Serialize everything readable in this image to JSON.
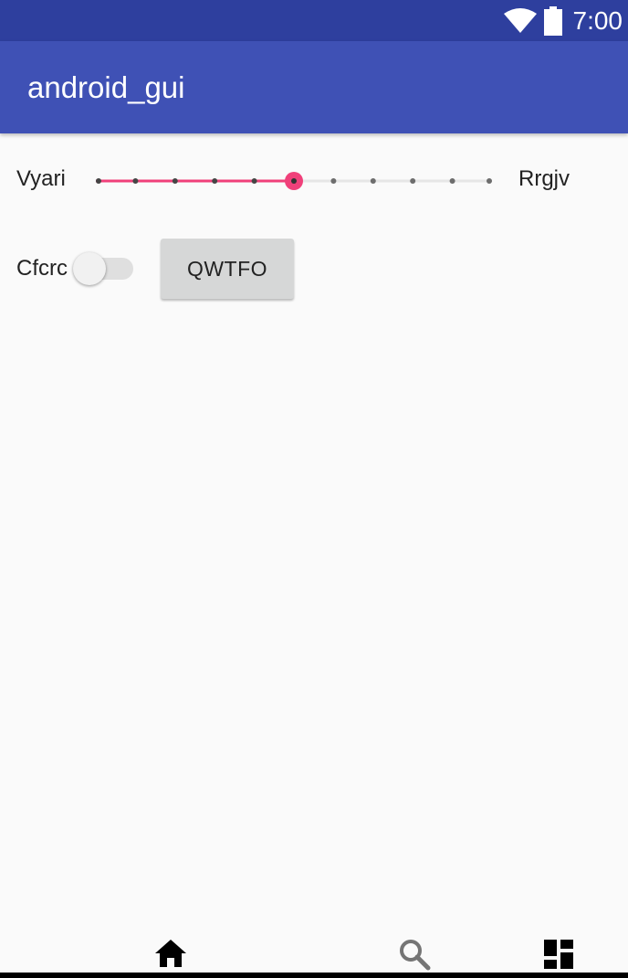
{
  "status_bar": {
    "time": "7:00",
    "icons": [
      "wifi-icon",
      "battery-icon"
    ],
    "background": "#2e3f9e"
  },
  "app_bar": {
    "title": "android_gui",
    "background": "#3f51b5"
  },
  "slider": {
    "left_label": "Vyari",
    "right_label": "Rrgjv",
    "steps": 10,
    "value": 5,
    "accent": "#f0407a"
  },
  "switch": {
    "label": "Cfcrc",
    "checked": false
  },
  "button": {
    "label": "QWTFO"
  },
  "bottom_nav": {
    "items": [
      "home-icon",
      "search-icon",
      "dashboard-icon"
    ]
  }
}
